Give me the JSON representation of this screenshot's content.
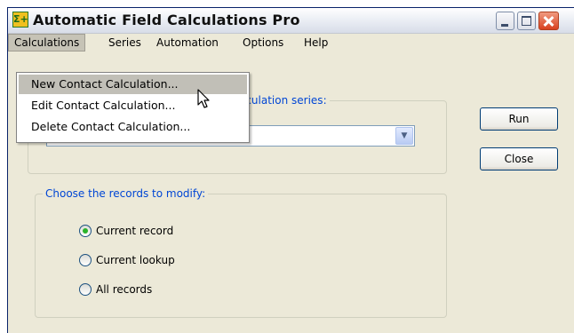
{
  "window": {
    "title": "Automatic Field Calculations Pro",
    "icon": "sigma-plus-icon"
  },
  "menubar": {
    "items": [
      {
        "label": "Calculations",
        "active": true
      },
      {
        "label": "Series"
      },
      {
        "label": "Automation"
      },
      {
        "label": "Options"
      },
      {
        "label": "Help"
      }
    ]
  },
  "calculations_menu": {
    "items": [
      {
        "label": "New Contact Calculation...",
        "highlighted": true
      },
      {
        "label": "Edit Contact Calculation..."
      },
      {
        "label": "Delete Contact Calculation..."
      }
    ]
  },
  "series_group": {
    "legend_visible_fragment": "lculation series:",
    "selected_value": ""
  },
  "records_group": {
    "legend": "Choose the records to modify:",
    "options": [
      {
        "label": "Current record",
        "checked": true
      },
      {
        "label": "Current lookup",
        "checked": false
      },
      {
        "label": "All records",
        "checked": false
      }
    ]
  },
  "buttons": {
    "run": "Run",
    "close": "Close"
  },
  "colors": {
    "window_bg": "#ece9d8",
    "legend_text": "#0046d5",
    "menu_highlight": "#c1bfb7"
  }
}
